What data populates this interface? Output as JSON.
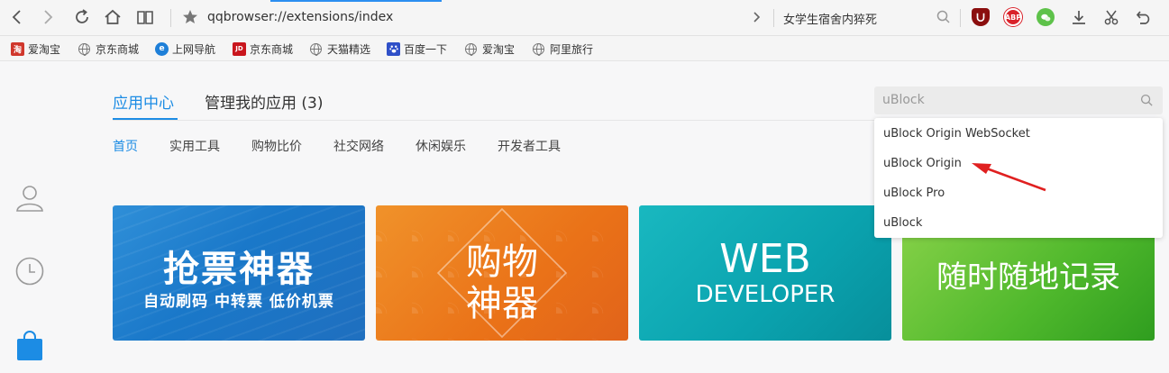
{
  "toolbar": {
    "url": "qqbrowser://extensions/index",
    "search_text": "女学生宿舍内猝死",
    "icons": [
      "back-icon",
      "forward-icon",
      "reload-icon",
      "home-icon",
      "reader-icon",
      "star-icon",
      "chevron-right-icon",
      "search-icon",
      "ublock-icon",
      "abp-icon",
      "wechat-icon",
      "download-icon",
      "scissors-icon",
      "undo-icon"
    ],
    "addon_abp_label": "ABP",
    "colors": {
      "loadbar": "#2b8ef0",
      "ublock": "#8b0e0e",
      "abp": "#d9222a",
      "wechat": "#5ec24a"
    }
  },
  "bookmarks": [
    {
      "label": "爱淘宝",
      "icon": "taobao-icon",
      "badge": "淘"
    },
    {
      "label": "京东商城",
      "icon": "globe-icon"
    },
    {
      "label": "上网导航",
      "icon": "ie-icon",
      "badge": "e"
    },
    {
      "label": "京东商城",
      "icon": "jd-icon",
      "badge": "JD"
    },
    {
      "label": "天猫精选",
      "icon": "globe-icon"
    },
    {
      "label": "百度一下",
      "icon": "baidu-paw-icon"
    },
    {
      "label": "爱淘宝",
      "icon": "globe-icon"
    },
    {
      "label": "阿里旅行",
      "icon": "globe-icon"
    }
  ],
  "sidebar": {
    "icons": [
      "user-icon",
      "history-clock-icon",
      "shopping-bag-icon"
    ]
  },
  "main": {
    "tabs": [
      {
        "label": "应用中心",
        "active": true
      },
      {
        "label": "管理我的应用 (3)",
        "active": false
      }
    ],
    "categories": [
      {
        "label": "首页",
        "active": true
      },
      {
        "label": "实用工具"
      },
      {
        "label": "购物比价"
      },
      {
        "label": "社交网络"
      },
      {
        "label": "休闲娱乐"
      },
      {
        "label": "开发者工具"
      }
    ],
    "accent": "#1c8ce4"
  },
  "search": {
    "value": "uBlock",
    "suggestions": [
      "uBlock Origin WebSocket",
      "uBlock Origin",
      "uBlock Pro",
      "uBlock"
    ],
    "annotation_color": "#e02020"
  },
  "banners": [
    {
      "title": "抢票神器",
      "subtitle": "自动刷码 中转票 低价机票"
    },
    {
      "line1": "购物",
      "line2": "神器"
    },
    {
      "line1": "WEB",
      "line2": "DEVELOPER"
    },
    {
      "title": "随时随地记录"
    }
  ]
}
